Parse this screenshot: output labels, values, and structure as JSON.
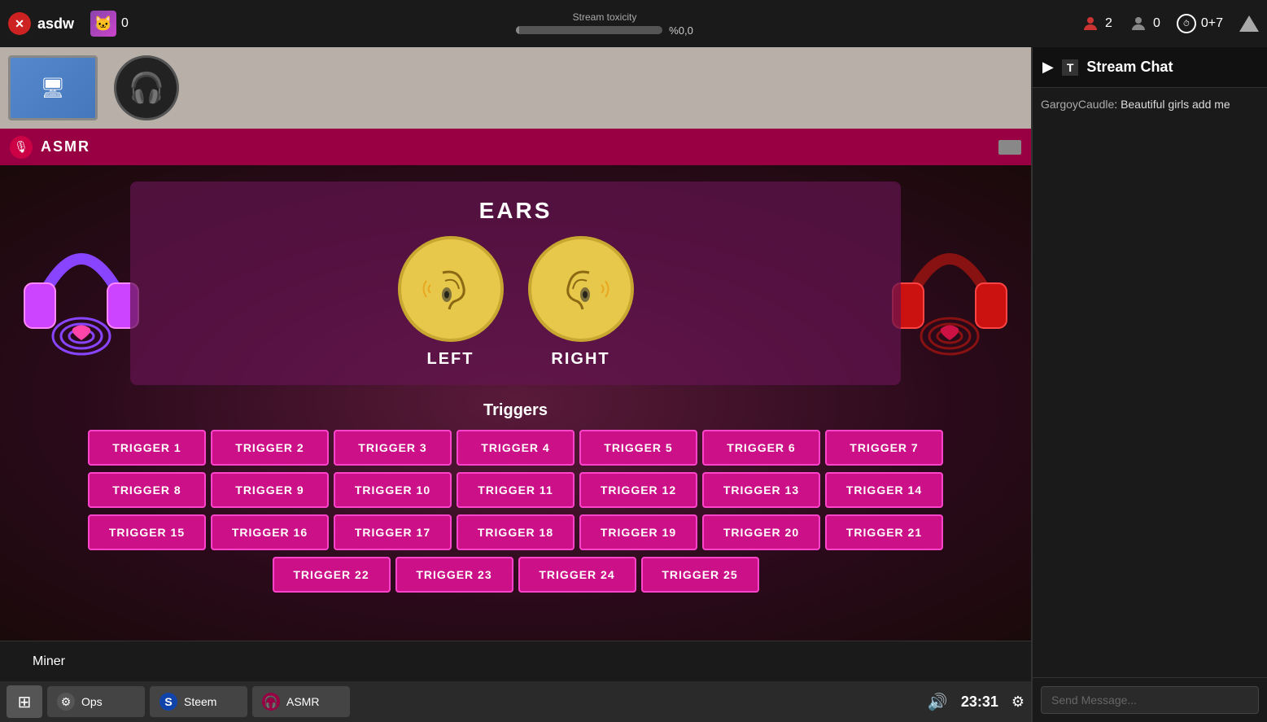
{
  "topbar": {
    "app_name": "asdw",
    "cat_count": "0",
    "toxicity_label": "Stream toxicity",
    "toxicity_pct": "%0,0",
    "viewer_count": "2",
    "anon_count": "0",
    "timer": "0+7"
  },
  "asmr": {
    "title": "ASMR",
    "ears_title": "EARS",
    "left_label": "LEFT",
    "right_label": "RIGHT",
    "triggers_title": "Triggers",
    "triggers": [
      "TRIGGER 1",
      "TRIGGER 2",
      "TRIGGER 3",
      "TRIGGER 4",
      "TRIGGER 5",
      "TRIGGER 6",
      "TRIGGER 7",
      "TRIGGER 8",
      "TRIGGER 9",
      "TRIGGER 10",
      "TRIGGER 11",
      "TRIGGER 12",
      "TRIGGER 13",
      "TRIGGER 14",
      "TRIGGER 15",
      "TRIGGER 16",
      "TRIGGER 17",
      "TRIGGER 18",
      "TRIGGER 19",
      "TRIGGER 20",
      "TRIGGER 21",
      "TRIGGER 22",
      "TRIGGER 23",
      "TRIGGER 24",
      "TRIGGER 25"
    ]
  },
  "bottom": {
    "miner_label": "Miner"
  },
  "taskbar": {
    "items": [
      {
        "label": "Ops",
        "icon": "⚙"
      },
      {
        "label": "Steem",
        "icon": "S"
      },
      {
        "label": "ASMR",
        "icon": "🎧"
      }
    ],
    "clock": "23:31"
  },
  "chat": {
    "title": "Stream Chat",
    "messages": [
      {
        "user": "GargoyCaudle",
        "text": "Beautiful girls add me"
      }
    ],
    "input_placeholder": "Send Message..."
  }
}
